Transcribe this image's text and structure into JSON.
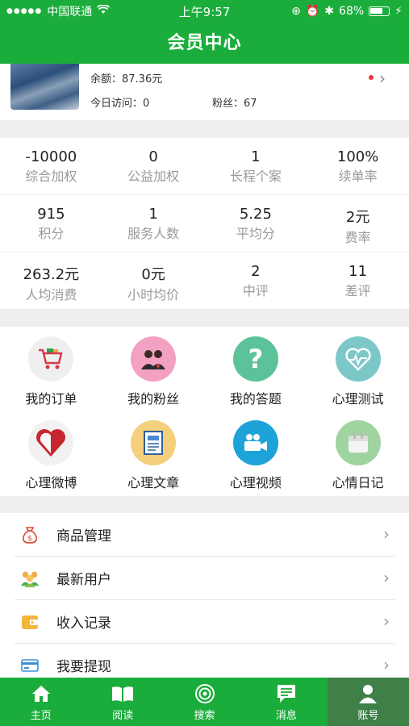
{
  "status_bar": {
    "carrier": "中国联通",
    "time": "上午9:57",
    "battery": "68%"
  },
  "header": {
    "title": "会员中心"
  },
  "profile": {
    "balance_label": "余额：87.36元",
    "visits_label": "今日访问：0",
    "fans_label": "粉丝：67"
  },
  "stats": [
    [
      {
        "value": "-10000",
        "label": "综合加权"
      },
      {
        "value": "0",
        "label": "公益加权"
      },
      {
        "value": "1",
        "label": "长程个案"
      },
      {
        "value": "100%",
        "label": "续单率"
      }
    ],
    [
      {
        "value": "915",
        "label": "积分"
      },
      {
        "value": "1",
        "label": "服务人数"
      },
      {
        "value": "5.25",
        "label": "平均分"
      },
      {
        "value": "2元",
        "label": "费率"
      }
    ],
    [
      {
        "value": "263.2元",
        "label": "人均消费"
      },
      {
        "value": "0元",
        "label": "小时均价"
      },
      {
        "value": "2",
        "label": "中评"
      },
      {
        "value": "11",
        "label": "差评"
      }
    ]
  ],
  "grid": [
    {
      "label": "我的订单",
      "icon": "shopping-cart-icon",
      "bg": "#efefef"
    },
    {
      "label": "我的粉丝",
      "icon": "fans-icon",
      "bg": "#f2a1c3"
    },
    {
      "label": "我的答题",
      "icon": "question-icon",
      "bg": "#5cc29a"
    },
    {
      "label": "心理测试",
      "icon": "heart-pulse-icon",
      "bg": "#7cc8c8"
    },
    {
      "label": "心理微博",
      "icon": "heart-icon",
      "bg": "#f1f1f1"
    },
    {
      "label": "心理文章",
      "icon": "article-icon",
      "bg": "#f4cf7c"
    },
    {
      "label": "心理视频",
      "icon": "video-camera-icon",
      "bg": "#1ea3d8"
    },
    {
      "label": "心情日记",
      "icon": "diary-icon",
      "bg": "#9fd39f"
    }
  ],
  "list": [
    {
      "label": "商品管理",
      "icon": "money-bag-icon"
    },
    {
      "label": "最新用户",
      "icon": "users-icon"
    },
    {
      "label": "收入记录",
      "icon": "wallet-icon"
    },
    {
      "label": "我要提现",
      "icon": "card-icon"
    }
  ],
  "tabs": [
    {
      "label": "主页",
      "icon": "home-icon"
    },
    {
      "label": "阅读",
      "icon": "book-icon"
    },
    {
      "label": "搜索",
      "icon": "radar-icon"
    },
    {
      "label": "消息",
      "icon": "message-icon"
    },
    {
      "label": "账号",
      "icon": "account-icon"
    }
  ],
  "colors": {
    "brand": "#1aad3b",
    "active_tab": "#3f7f48"
  }
}
